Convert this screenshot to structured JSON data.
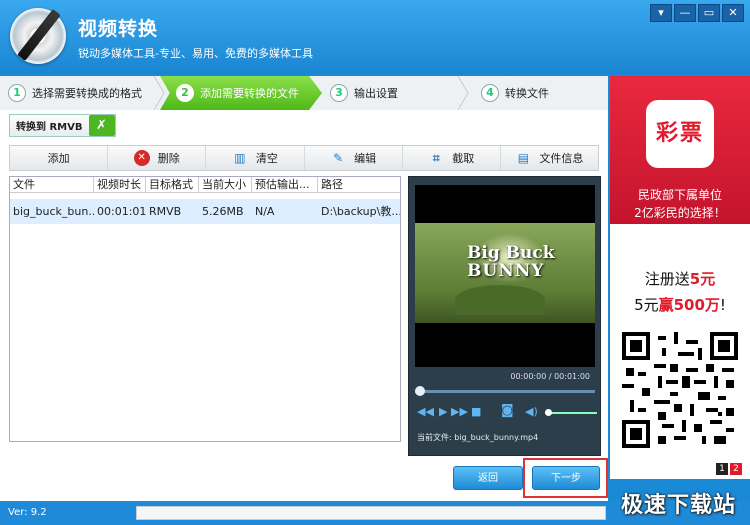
{
  "app": {
    "title": "视频转换",
    "subtitle": "锐动多媒体工具-专业、易用、免费的多媒体工具"
  },
  "window_controls": [
    "▾",
    "—",
    "▭",
    "✕"
  ],
  "steps": [
    {
      "num": "1",
      "label": "选择需要转换成的格式"
    },
    {
      "num": "2",
      "label": "添加需要转换的文件"
    },
    {
      "num": "3",
      "label": "输出设置"
    },
    {
      "num": "4",
      "label": "转换文件"
    }
  ],
  "convert_target": "转换到 RMVB",
  "toolbar": {
    "add": "添加",
    "delete": "删除",
    "clear": "清空",
    "edit": "编辑",
    "crop": "截取",
    "info": "文件信息"
  },
  "table": {
    "headers": [
      "文件",
      "视频时长",
      "目标格式",
      "当前大小",
      "预估输出...",
      "路径"
    ],
    "rows": [
      [
        "big_buck_bun...",
        "00:01:01",
        "RMVB",
        "5.26MB",
        "N/A",
        "D:\\backup\\教..."
      ]
    ]
  },
  "player": {
    "title_line1": "Big Buck",
    "title_line2": "BUNNY",
    "time": "00:00:00 / 00:01:00",
    "current_file": "当前文件: big_buck_bunny.mp4",
    "seek_fraction": 0.0,
    "volume_fraction": 0.0
  },
  "buttons": {
    "back": "返回",
    "next": "下一步"
  },
  "status": {
    "version": "Ver: 9.2",
    "progress_percent": 0,
    "watermark": "极速下载站"
  },
  "ad": {
    "badge": "彩票",
    "line1": "民政部下属单位",
    "line2": "2亿彩民的选择！",
    "reg1_prefix": "注册送",
    "reg1_highlight": "5元",
    "reg2_prefix": "5元",
    "reg2_highlight": "赢500万",
    "reg2_suffix": "!",
    "pages": [
      "1",
      "2"
    ]
  },
  "colors": {
    "header_blue": "#1a86d2",
    "step_active_green": "#4fb818",
    "ad_red": "#e01b2d"
  }
}
